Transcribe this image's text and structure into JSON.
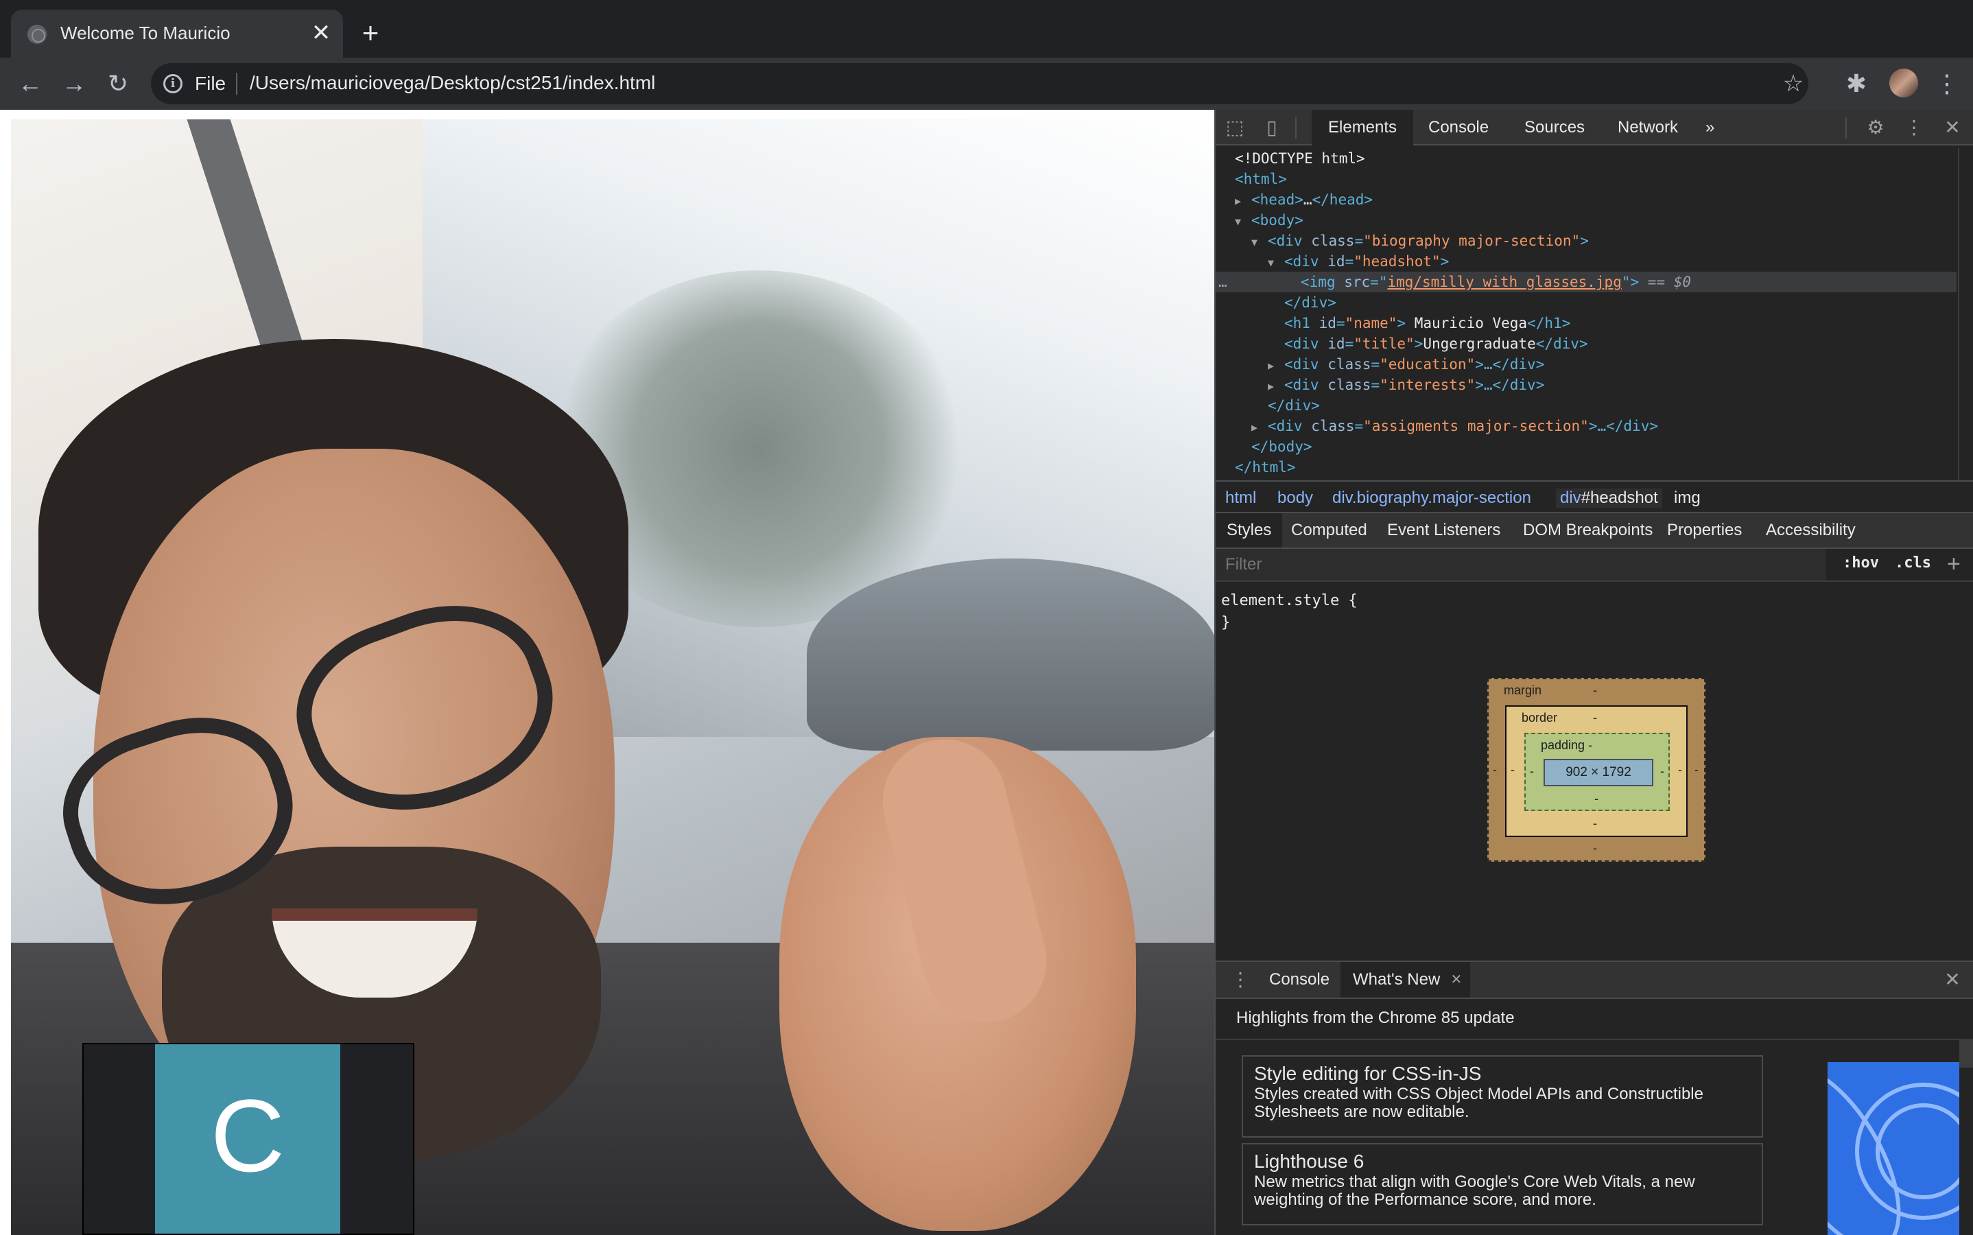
{
  "browser": {
    "tab": {
      "title": "Welcome To Mauricio",
      "close": "✕"
    },
    "new_tab": "+",
    "toolbar": {
      "back": "←",
      "forward": "→",
      "reload": "↻",
      "scheme": "File",
      "url": "/Users/mauriciovega/Desktop/cst251/index.html",
      "star": "☆",
      "extensions": "✱",
      "menu": "⋮"
    }
  },
  "page": {
    "video_tile": {
      "initial": "C",
      "avatar_color": "#4394a8"
    }
  },
  "devtools": {
    "tabs": [
      "Elements",
      "Console",
      "Sources",
      "Network"
    ],
    "more_tabs": "»",
    "dom": {
      "l1": "<!DOCTYPE html>",
      "l2_tag": "<html>",
      "l3_tag_open": "<head>",
      "l3_ellipsis": "…",
      "l3_tag_close": "</head>",
      "l4_tag": "<body>",
      "l5_tag": "<div",
      "l5_attr": "class",
      "l5_val": "\"biography major-section\"",
      "l6_tag": "<div",
      "l6_attr": "id",
      "l6_val": "\"headshot\"",
      "l7_tag": "<img",
      "l7_attr": "src",
      "l7_val": "img/smilly with glasses.jpg",
      "l7_suffix": "== $0",
      "l8_tag": "</div>",
      "l9_tag": "<h1",
      "l9_attr": "id",
      "l9_val": "\"name\"",
      "l9_text": " Mauricio Vega",
      "l9_close": "</h1>",
      "l10_tag": "<div",
      "l10_attr": "id",
      "l10_val": "\"title\"",
      "l10_text": "Ungergraduate",
      "l10_close": "</div>",
      "l11_tag": "<div",
      "l11_attr": "class",
      "l11_val": "\"education\"",
      "l11_rest": ">…</div>",
      "l12_tag": "<div",
      "l12_attr": "class",
      "l12_val": "\"interests\"",
      "l12_rest": ">…</div>",
      "l13_tag": "</div>",
      "l14_tag": "<div",
      "l14_attr": "class",
      "l14_val": "\"assigments major-section\"",
      "l14_rest": ">…</div>",
      "l15_tag": "</body>",
      "l16_tag": "</html>"
    },
    "breadcrumbs": {
      "c1": "html",
      "c2": "body",
      "c3": "div.biography.major-section",
      "c4_prefix": "div",
      "c4_hl": "#headshot",
      "c5": "img"
    },
    "style_tabs": [
      "Styles",
      "Computed",
      "Event Listeners",
      "DOM Breakpoints",
      "Properties",
      "Accessibility"
    ],
    "filter_placeholder": "Filter",
    "hov": ":hov",
    "cls": ".cls",
    "add_rule": "+",
    "rule_open": "element.style {",
    "rule_close": "}",
    "box_model": {
      "margin_label": "margin",
      "border_label": "border",
      "padding_label": "padding -",
      "content_size": "902 × 1792",
      "dash": "-"
    },
    "drawer": {
      "tabs": [
        "Console",
        "What's New"
      ],
      "close_tab": "✕",
      "close_drawer": "✕",
      "headline": "Highlights from the Chrome 85 update",
      "cards": [
        {
          "title": "Style editing for CSS-in-JS",
          "body": "Styles created with CSS Object Model APIs and Constructible Stylesheets are now editable."
        },
        {
          "title": "Lighthouse 6",
          "body": "New metrics that align with Google's Core Web Vitals, a new weighting of the Performance score, and more."
        }
      ]
    }
  }
}
